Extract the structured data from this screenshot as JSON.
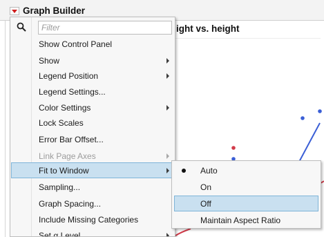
{
  "window": {
    "title": "Graph Builder"
  },
  "graph": {
    "title": "ight vs. height"
  },
  "menu": {
    "filter_placeholder": "Filter",
    "items": [
      {
        "label": "Show Control Panel",
        "has_submenu": false,
        "enabled": true
      },
      {
        "label": "Show",
        "has_submenu": true,
        "enabled": true
      },
      {
        "label": "Legend Position",
        "has_submenu": true,
        "enabled": true
      },
      {
        "label": "Legend Settings...",
        "has_submenu": false,
        "enabled": true
      },
      {
        "label": "Color Settings",
        "has_submenu": true,
        "enabled": true
      },
      {
        "label": "Lock Scales",
        "has_submenu": false,
        "enabled": true
      },
      {
        "label": "Error Bar Offset...",
        "has_submenu": false,
        "enabled": true
      },
      {
        "label": "Link Page Axes",
        "has_submenu": true,
        "enabled": false
      },
      {
        "label": "Fit to Window",
        "has_submenu": true,
        "enabled": true,
        "highlighted": true
      },
      {
        "label": "Sampling...",
        "has_submenu": false,
        "enabled": true
      },
      {
        "label": "Graph Spacing...",
        "has_submenu": false,
        "enabled": true
      },
      {
        "label": "Include Missing Categories",
        "has_submenu": false,
        "enabled": true
      },
      {
        "label": "Set α Level",
        "has_submenu": true,
        "enabled": true
      }
    ]
  },
  "submenu": {
    "items": [
      {
        "label": "Auto",
        "checked": true
      },
      {
        "label": "On",
        "checked": false
      },
      {
        "label": "Off",
        "checked": false,
        "highlighted": true
      },
      {
        "label": "Maintain Aspect Ratio",
        "checked": false
      }
    ]
  },
  "colors": {
    "accent_red": "#d01c1c",
    "series_blue": "#3b5fd6",
    "series_red": "#d23b4a",
    "highlight": "#c9e0f0",
    "highlight_border": "#7eb4d8"
  },
  "icons": {
    "red_triangle": "red-triangle-menu-icon",
    "search": "search-icon",
    "submenu_arrow": "chevron-right-icon"
  }
}
